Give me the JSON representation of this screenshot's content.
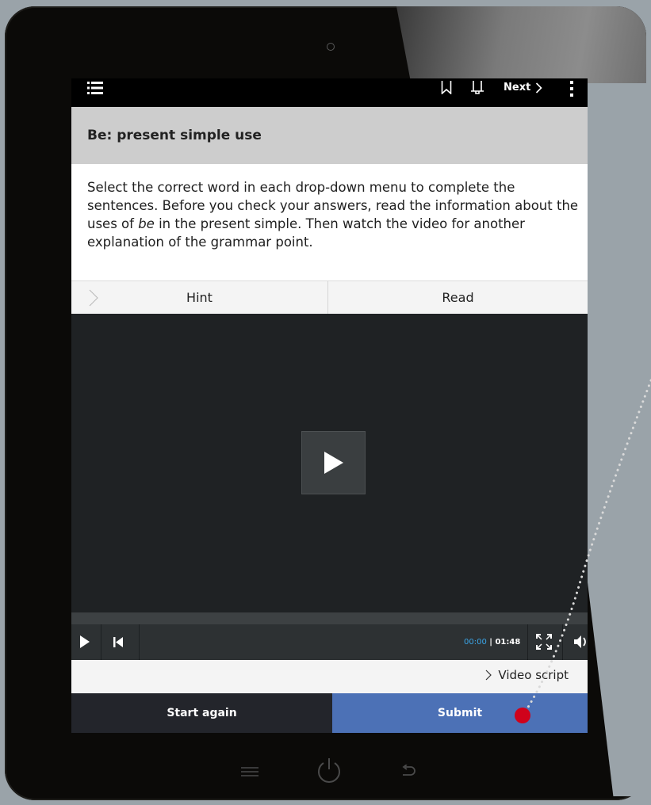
{
  "topbar": {
    "next_label": "Next"
  },
  "page": {
    "title": "Be: present simple use",
    "instructions_part1": "Select the correct word in each drop-down menu to complete the sentences. Before you check your answers, read the information about the uses of ",
    "instructions_italic": "be",
    "instructions_part2": " in the present simple. Then watch the video for another explanation of the grammar point."
  },
  "tabs": {
    "hint_label": "Hint",
    "read_label": "Read"
  },
  "video": {
    "current_time": "00:00",
    "separator": " | ",
    "duration": "01:48",
    "progress": 0
  },
  "script": {
    "label": "Video script"
  },
  "actions": {
    "start_again_label": "Start again",
    "submit_label": "Submit"
  },
  "colors": {
    "submit": "#4c71b6",
    "start_again": "#23252b",
    "time_accent": "#3aa4e6",
    "pointer_dot": "#d0021b"
  },
  "icons": {
    "menu": "menu-list-icon",
    "bookmark": "bookmark-icon",
    "bell": "bell-icon",
    "more": "kebab-icon",
    "play": "play-icon",
    "skip_back": "skip-back-icon",
    "fullscreen": "fullscreen-icon",
    "volume": "volume-icon"
  }
}
